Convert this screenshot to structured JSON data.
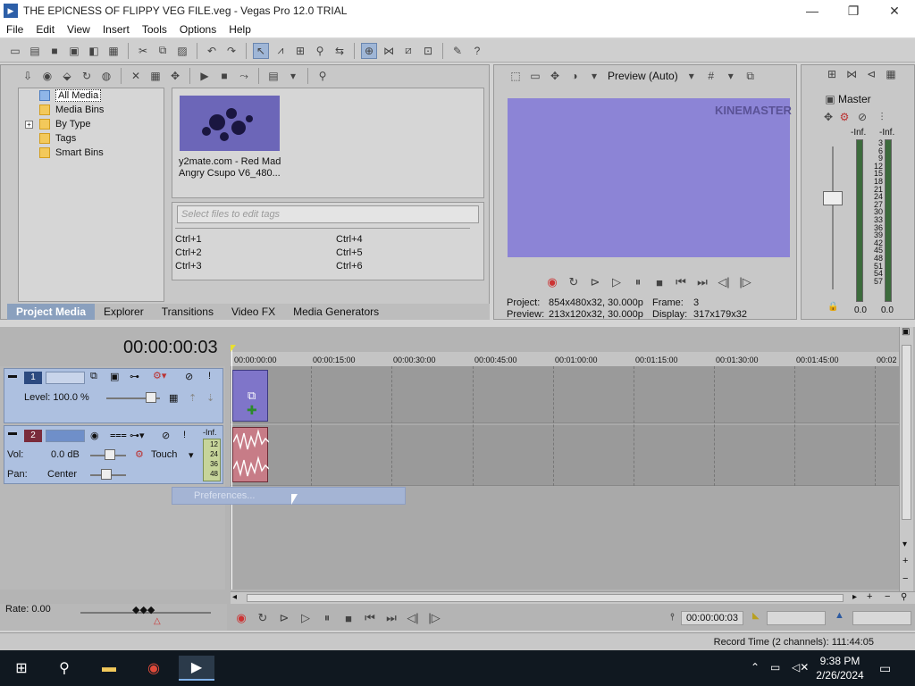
{
  "window": {
    "title": "THE EPICNESS OF FLIPPY VEG FILE.veg - Vegas Pro 12.0 TRIAL",
    "app_icon": "vegas-icon"
  },
  "menu": [
    "File",
    "Edit",
    "View",
    "Insert",
    "Tools",
    "Options",
    "Help"
  ],
  "media": {
    "tree": [
      {
        "label": "All Media",
        "selected": true
      },
      {
        "label": "Media Bins"
      },
      {
        "label": "By Type",
        "expandable": true
      },
      {
        "label": "Tags"
      },
      {
        "label": "Smart Bins"
      }
    ],
    "file_caption_line1": "y2mate.com - Red Mad",
    "file_caption_line2": "Angry Csupo V6_480...",
    "tag_placeholder": "Select files to edit tags",
    "shortcuts": [
      "Ctrl+1",
      "Ctrl+2",
      "Ctrl+3",
      "Ctrl+4",
      "Ctrl+5",
      "Ctrl+6"
    ],
    "tabs": [
      {
        "label": "Project Media",
        "active": true
      },
      {
        "label": "Explorer"
      },
      {
        "label": "Transitions"
      },
      {
        "label": "Video FX"
      },
      {
        "label": "Media Generators"
      }
    ]
  },
  "preview": {
    "mode": "Preview (Auto)",
    "watermark": "KINEMASTER",
    "project_label": "Project:",
    "project_value": "854x480x32, 30.000p",
    "frame_label": "Frame:",
    "frame_value": "3",
    "preview_label": "Preview:",
    "preview_value": "213x120x32, 30.000p",
    "display_label": "Display:",
    "display_value": "317x179x32"
  },
  "master": {
    "label": "Master",
    "peak_left": "-Inf.",
    "peak_right": "-Inf.",
    "scale": [
      "3",
      "6",
      "9",
      "12",
      "15",
      "18",
      "21",
      "24",
      "27",
      "30",
      "33",
      "36",
      "39",
      "42",
      "45",
      "48",
      "51",
      "54",
      "57"
    ],
    "fader_left": "0.0",
    "fader_right": "0.0"
  },
  "timeline": {
    "cursor_time": "00:00:00:03",
    "ruler": [
      "00:00:00:00",
      "00:00:15:00",
      "00:00:30:00",
      "00:00:45:00",
      "00:01:00:00",
      "00:01:15:00",
      "00:01:30:00",
      "00:01:45:00",
      "00:02"
    ],
    "track1": {
      "number": "1",
      "level_label": "Level: 100.0 %"
    },
    "track2": {
      "number": "2",
      "vol_label": "Vol:",
      "vol_value": "0.0 dB",
      "pan_label": "Pan:",
      "pan_value": "Center",
      "mode": "Touch",
      "meter_label": "-Inf.",
      "meter_scale": [
        "12",
        "24",
        "36",
        "48"
      ]
    },
    "context_menu_item": "Preferences...",
    "rate_label": "Rate: 0.00",
    "transport_time": "00:00:00:03",
    "status": "Record Time (2 channels): 111:44:05"
  },
  "taskbar": {
    "time": "9:38 PM",
    "date": "2/26/2024"
  }
}
